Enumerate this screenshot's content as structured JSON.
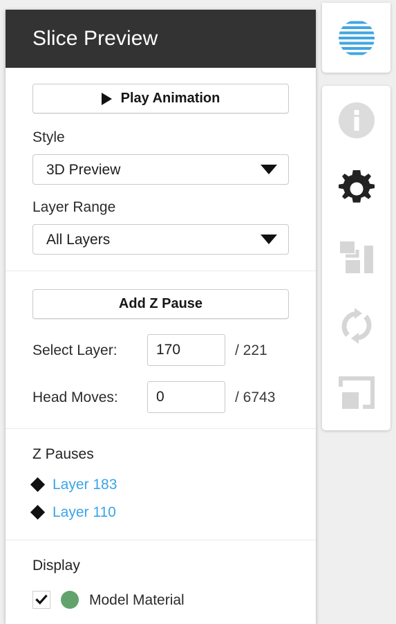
{
  "panel": {
    "title": "Slice Preview",
    "play_button": {
      "label": "Play Animation",
      "icon": "play-icon"
    },
    "style": {
      "label": "Style",
      "value": "3D Preview"
    },
    "layer_range": {
      "label": "Layer Range",
      "value": "All Layers"
    },
    "add_z_pause_button": {
      "label": "Add Z Pause"
    },
    "select_layer": {
      "label": "Select Layer:",
      "value": "170",
      "total": "/ 221"
    },
    "head_moves": {
      "label": "Head Moves:",
      "value": "0",
      "total": "/ 6743"
    },
    "z_pauses": {
      "heading": "Z Pauses",
      "items": [
        {
          "label": "Layer 183"
        },
        {
          "label": "Layer 110"
        }
      ]
    },
    "display": {
      "heading": "Display",
      "items": [
        {
          "label": "Model Material",
          "checked": "✔",
          "color": "#62a36d"
        }
      ]
    }
  },
  "toolbar": {
    "items": [
      {
        "name": "slice-preview-icon",
        "state": "active"
      },
      {
        "name": "info-icon",
        "state": "inactive"
      },
      {
        "name": "settings-gear-icon",
        "state": "active"
      },
      {
        "name": "arrange-layout-icon",
        "state": "inactive"
      },
      {
        "name": "refresh-sync-icon",
        "state": "inactive"
      },
      {
        "name": "scale-resize-icon",
        "state": "inactive"
      }
    ]
  },
  "colors": {
    "header_bg": "#333333",
    "link_blue": "#3aa4e5",
    "accent_blue": "#41a6e0",
    "model_material": "#62a36d",
    "page_bg": "#efeff0"
  }
}
